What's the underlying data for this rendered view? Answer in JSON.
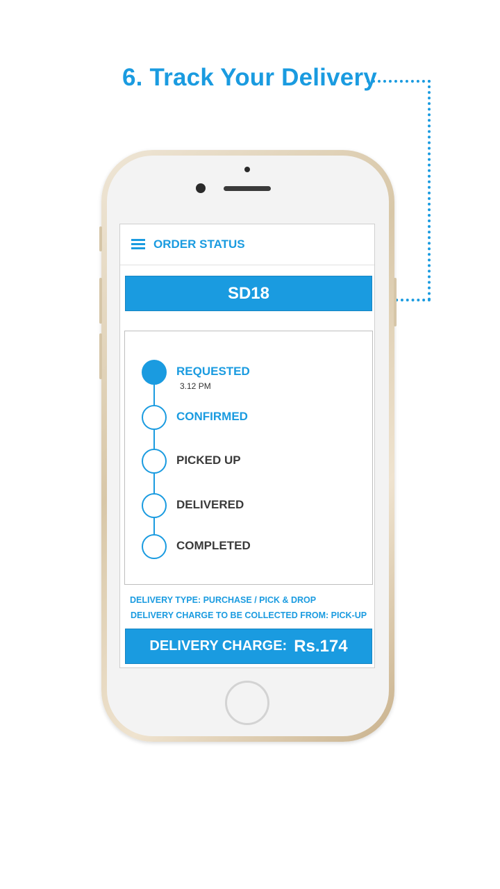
{
  "headline": "6. Track Your Delivery",
  "screen": {
    "header_title": "ORDER STATUS",
    "order_id": "SD18",
    "steps": [
      {
        "label": "REQUESTED",
        "time": "3.12 PM",
        "state": "done"
      },
      {
        "label": "CONFIRMED",
        "state": "current"
      },
      {
        "label": "PICKED UP",
        "state": "pending"
      },
      {
        "label": "DELIVERED",
        "state": "pending"
      },
      {
        "label": "COMPLETED",
        "state": "pending"
      }
    ],
    "delivery_type": "DELIVERY TYPE: PURCHASE / PICK & DROP",
    "charge_collected_from": "DELIVERY CHARGE TO BE COLLECTED FROM: PICK-UP",
    "charge_label": "DELIVERY CHARGE:",
    "charge_value": "Rs.174"
  },
  "colors": {
    "accent": "#1a9be0",
    "text_dark": "#3a3a3a"
  },
  "icons": [
    "menu-icon",
    "status-circle-icon"
  ]
}
